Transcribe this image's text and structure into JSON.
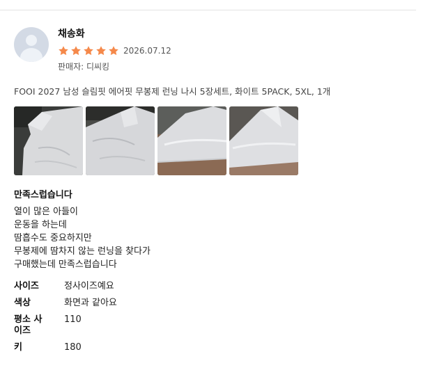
{
  "review": {
    "author": "채송화",
    "rating": 5,
    "rating_max": 5,
    "date": "2026.07.12",
    "seller": "판매자: 디씨킹",
    "product": "FOOI 2027 남성 슬림핏 에어핏 무봉제 런닝 나시 5장세트, 화이트 5PACK, 5XL, 1개",
    "photos": [
      {
        "icon": "shirt-photo-1"
      },
      {
        "icon": "shirt-photo-2"
      },
      {
        "icon": "shirt-photo-3"
      },
      {
        "icon": "shirt-photo-4"
      }
    ],
    "headline": "만족스럽습니다",
    "body_lines": [
      "열이 많은 아들이",
      "운동을 하는데",
      "땀흡수도 중요하지만",
      "무봉제에 땀차지 않는 런닝을 찾다가",
      "구매했는데 만족스럽습니다"
    ],
    "survey": [
      {
        "q": "사이즈",
        "a": "정사이즈예요"
      },
      {
        "q": "색상",
        "a": "화면과 같아요"
      },
      {
        "q": "평소 사\n이즈",
        "a": "110"
      },
      {
        "q": "키",
        "a": "180"
      }
    ]
  },
  "colors": {
    "star": "#f5894b",
    "avatar": "#d3dae5"
  }
}
